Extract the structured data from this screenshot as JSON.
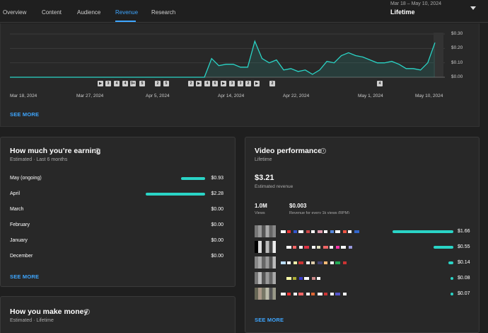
{
  "tabs": [
    {
      "label": "Overview"
    },
    {
      "label": "Content"
    },
    {
      "label": "Audience"
    },
    {
      "label": "Revenue"
    },
    {
      "label": "Research"
    }
  ],
  "date_range": {
    "subtitle": "Mar 18 – May 10, 2024",
    "label": "Lifetime"
  },
  "revenue_chart": {
    "y_ticks": [
      "$0.30",
      "$0.20",
      "$0.10",
      "$0.00"
    ],
    "x_ticks": [
      "Mar 18, 2024",
      "Mar 27, 2024",
      "Apr 5, 2024",
      "Apr 14, 2024",
      "Apr 22, 2024",
      "May 1, 2024",
      "May 10, 2024"
    ],
    "markers": [
      "▶",
      "3",
      "4",
      "4",
      "9+",
      "5",
      "2",
      "5",
      "2",
      "▶",
      "4",
      "6",
      "▶",
      "3",
      "3",
      "2",
      "▶",
      "2",
      "4"
    ],
    "values": [
      0,
      0,
      0,
      0,
      0,
      0,
      0,
      0,
      0,
      0,
      0,
      0,
      0,
      0,
      0,
      0,
      0,
      0,
      0,
      0,
      0,
      0,
      0,
      0,
      0,
      0,
      0,
      0,
      0.13,
      0.08,
      0.09,
      0.09,
      0.07,
      0.07,
      0.25,
      0.13,
      0.1,
      0.12,
      0.05,
      0.06,
      0.04,
      0.05,
      0.02,
      0.05,
      0.11,
      0.1,
      0.15,
      0.17,
      0.15,
      0.14,
      0.12,
      0.1,
      0.1,
      0.11,
      0.09,
      0.06,
      0.06,
      0.05,
      0.1,
      0.24
    ],
    "see_more": "SEE MORE"
  },
  "earning": {
    "title": "How much you’re earning",
    "subtitle": "Estimated · Last 6 months",
    "rows": [
      {
        "label": "May (ongoing)",
        "value": "$0.93",
        "amount": 0.93
      },
      {
        "label": "April",
        "value": "$2.28",
        "amount": 2.28
      },
      {
        "label": "March",
        "value": "$0.00",
        "amount": 0
      },
      {
        "label": "February",
        "value": "$0.00",
        "amount": 0
      },
      {
        "label": "January",
        "value": "$0.00",
        "amount": 0
      },
      {
        "label": "December",
        "value": "$0.00",
        "amount": 0
      }
    ],
    "see_more": "SEE MORE"
  },
  "make_money": {
    "title": "How you make money",
    "subtitle": "Estimated · Lifetime"
  },
  "video_perf": {
    "title": "Video performance",
    "subtitle": "Lifetime",
    "revenue": "$3.21",
    "revenue_label": "Estimated revenue",
    "views": "1.0M",
    "views_label": "Views",
    "rpm": "$0.003",
    "rpm_label": "Revenue for every 1k views (RPM)",
    "videos": [
      {
        "value": "$1.66",
        "amount": 1.66
      },
      {
        "value": "$0.55",
        "amount": 0.55
      },
      {
        "value": "$0.14",
        "amount": 0.14
      },
      {
        "value": "$0.08",
        "amount": 0.08
      },
      {
        "value": "$0.07",
        "amount": 0.07
      }
    ],
    "see_more": "SEE MORE"
  },
  "colors": {
    "accent": "#3ea6ff",
    "bar": "#2ad4c6",
    "bg": "#1f1f1f",
    "card": "#282828"
  }
}
